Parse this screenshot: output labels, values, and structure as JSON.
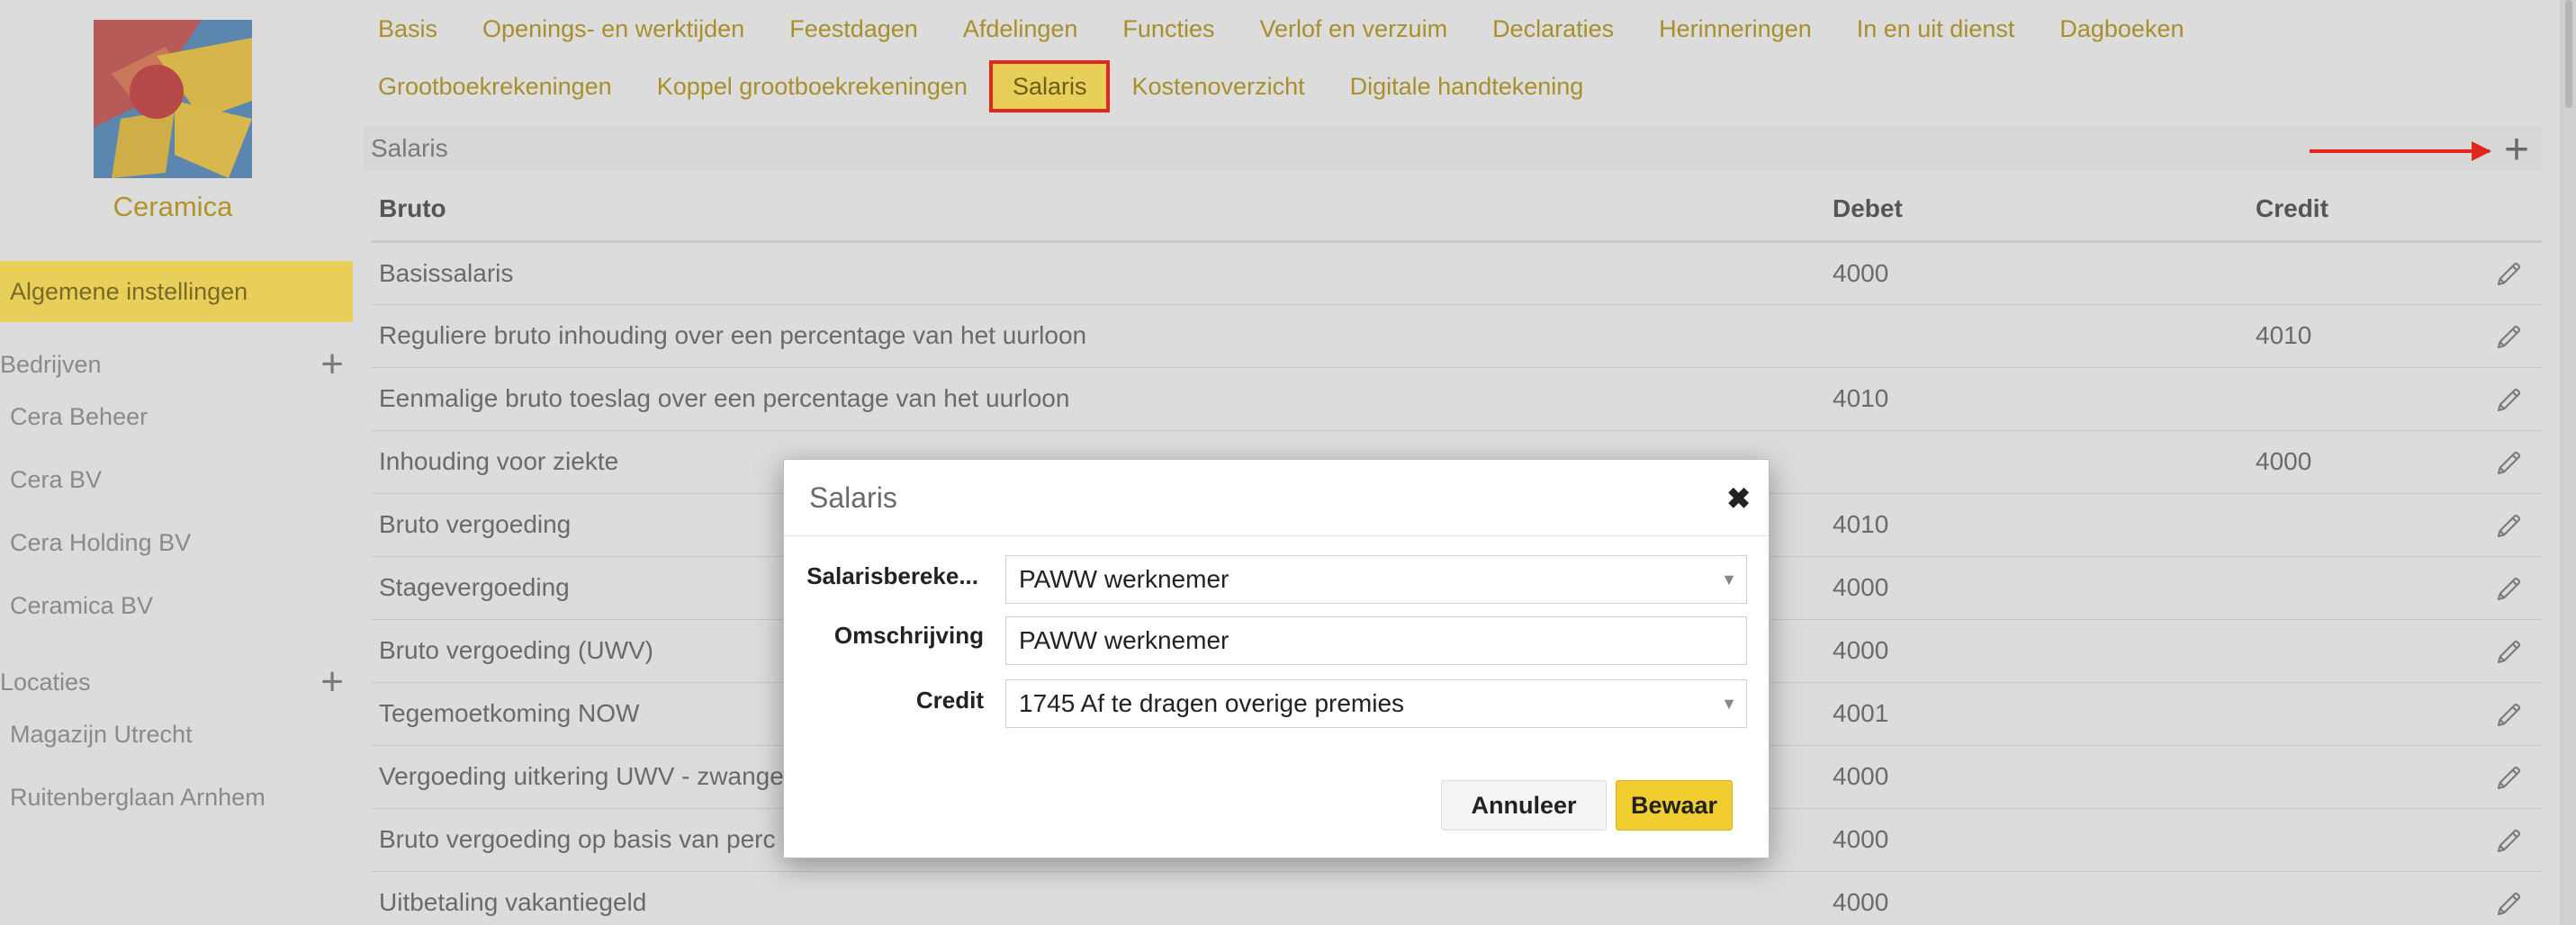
{
  "company": {
    "name": "Ceramica"
  },
  "sidebar": {
    "active": "Algemene instellingen",
    "sections": [
      {
        "label": "Bedrijven",
        "items": [
          "Cera Beheer",
          "Cera BV",
          "Cera Holding BV",
          "Ceramica BV"
        ]
      },
      {
        "label": "Locaties",
        "items": [
          "Magazijn Utrecht",
          "Ruitenberglaan Arnhem"
        ]
      }
    ]
  },
  "nav": {
    "row1": [
      "Basis",
      "Openings- en werktijden",
      "Feestdagen",
      "Afdelingen",
      "Functies",
      "Verlof en verzuim",
      "Declaraties",
      "Herinneringen",
      "In en uit dienst",
      "Dagboeken"
    ],
    "row2": [
      "Grootboekrekeningen",
      "Koppel grootboekrekeningen",
      "Salaris",
      "Kostenoverzicht",
      "Digitale handtekening"
    ],
    "active": "Salaris"
  },
  "panel": {
    "title": "Salaris"
  },
  "table": {
    "headers": {
      "bruto": "Bruto",
      "debet": "Debet",
      "credit": "Credit"
    },
    "rows": [
      {
        "name": "Basissalaris",
        "debet": "4000",
        "credit": ""
      },
      {
        "name": "Reguliere bruto inhouding over een percentage van het uurloon",
        "debet": "",
        "credit": "4010"
      },
      {
        "name": "Eenmalige bruto toeslag over een percentage van het uurloon",
        "debet": "4010",
        "credit": ""
      },
      {
        "name": "Inhouding voor ziekte",
        "debet": "",
        "credit": "4000"
      },
      {
        "name": "Bruto vergoeding",
        "debet": "4010",
        "credit": ""
      },
      {
        "name": "Stagevergoeding",
        "debet": "4000",
        "credit": ""
      },
      {
        "name": "Bruto vergoeding (UWV)",
        "debet": "4000",
        "credit": ""
      },
      {
        "name": "Tegemoetkoming NOW",
        "debet": "4001",
        "credit": ""
      },
      {
        "name": "Vergoeding uitkering UWV - zwange",
        "debet": "4000",
        "credit": ""
      },
      {
        "name": "Bruto vergoeding op basis van perc",
        "debet": "4000",
        "credit": ""
      },
      {
        "name": "Uitbetaling vakantiegeld",
        "debet": "4000",
        "credit": ""
      }
    ]
  },
  "modal": {
    "title": "Salaris",
    "close": "✖",
    "fields": [
      {
        "label": "Salarisbereke...",
        "value": "PAWW werknemer",
        "type": "select"
      },
      {
        "label": "Omschrijving",
        "value": "PAWW werknemer",
        "type": "text"
      },
      {
        "label": "Credit",
        "value": "1745 Af te dragen overige premies",
        "type": "select"
      }
    ],
    "cancel": "Annuleer",
    "save": "Bewaar"
  },
  "colors": {
    "accent": "#e8cf5a",
    "link": "#a88f2c",
    "highlight": "#e0281c",
    "save": "#f1cd2f"
  },
  "icons": {
    "add": "plus-icon",
    "edit": "pencil-icon",
    "close": "close-icon",
    "dropdown": "caret-down-icon"
  }
}
